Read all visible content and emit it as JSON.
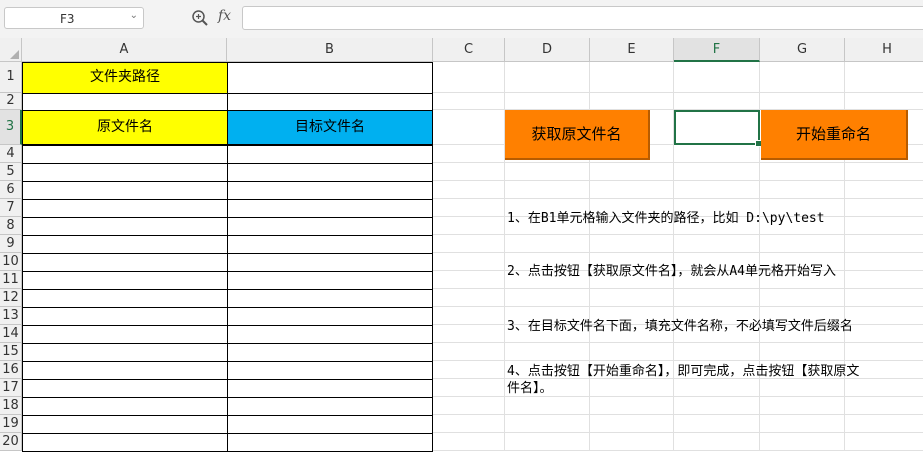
{
  "formula_bar": {
    "name_box": "F3",
    "name_box_dropdown_icon": "chevron-down-icon",
    "zoom_icon": "magnifier-icon",
    "fx_label": "fx",
    "formula_value": ""
  },
  "columns": [
    "A",
    "B",
    "C",
    "D",
    "E",
    "F",
    "G",
    "H"
  ],
  "selected_column": "F",
  "rows": [
    "1",
    "2",
    "3",
    "4",
    "5",
    "6",
    "7",
    "8",
    "9",
    "10",
    "11",
    "12",
    "13",
    "14",
    "15",
    "16",
    "17",
    "18",
    "19",
    "20"
  ],
  "selected_row": "3",
  "cells": {
    "A1": "文件夹路径",
    "A3": "原文件名",
    "B3": "目标文件名"
  },
  "buttons": {
    "get_names": "获取原文件名",
    "start_rename": "开始重命名"
  },
  "notes": [
    "1、在B1单元格输入文件夹的路径，比如 D:\\py\\test",
    "2、点击按钮【获取原文件名】，就会从A4单元格开始写入",
    "3、在目标文件名下面，填充文件名称，不必填写文件后缀名",
    "4、点击按钮【开始重命名】，即可完成，点击按钮【获取原文",
    "件名】。"
  ],
  "colors": {
    "yellow_fill": "#ffff00",
    "blue_fill": "#00b0f0",
    "button_orange": "#ff8000",
    "selection_green": "#217346"
  }
}
